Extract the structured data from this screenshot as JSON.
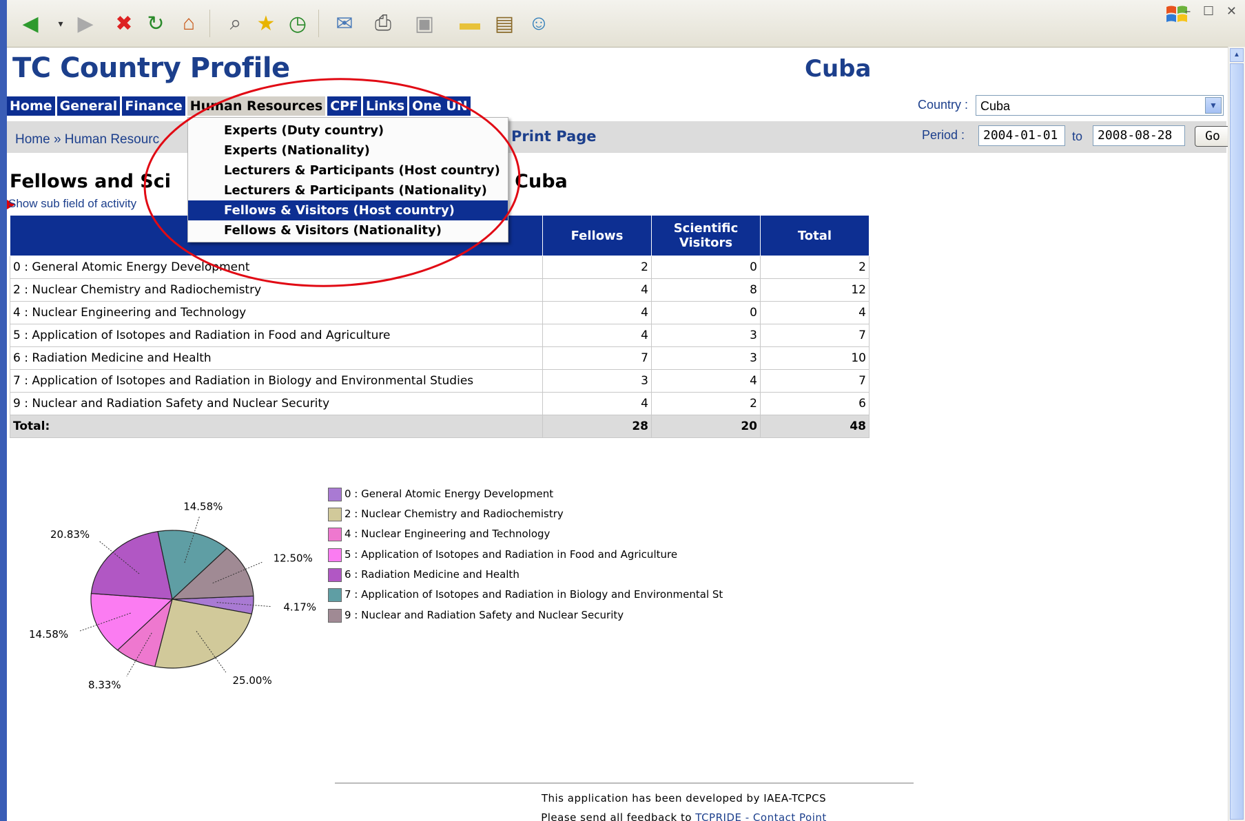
{
  "window": {
    "controls": "– ☐ ✕"
  },
  "header": {
    "app_title": "TC Country Profile",
    "country_title": "Cuba"
  },
  "nav": {
    "items": [
      "Home",
      "General",
      "Finance",
      "Human Resources",
      "CPF",
      "Links",
      "One UN"
    ]
  },
  "breadcrumb": "Home » Human Resourc",
  "print_page": "Print Page",
  "filters": {
    "country_label": "Country :",
    "country_value": "Cuba",
    "period_label": "Period :",
    "from": "2004-01-01",
    "to_label": "to",
    "to": "2008-08-28",
    "go": "Go"
  },
  "heading": {
    "left": "Fellows and Sci",
    "right": "ntry is Cuba"
  },
  "subfield_link": "Show sub field of activity",
  "dropdown_menu": {
    "items": [
      "Experts (Duty country)",
      "Experts (Nationality)",
      "Lecturers & Participants (Host country)",
      "Lecturers & Participants (Nationality)",
      "Fellows & Visitors (Host country)",
      "Fellows & Visitors (Nationality)"
    ],
    "selected_index": 4
  },
  "table": {
    "headers": [
      "",
      "Fellows",
      "Scientific Visitors",
      "Total"
    ],
    "rows": [
      {
        "field": "0 : General Atomic Energy Development",
        "fellows": "2",
        "visitors": "0",
        "total": "2"
      },
      {
        "field": "2 : Nuclear Chemistry and Radiochemistry",
        "fellows": "4",
        "visitors": "8",
        "total": "12"
      },
      {
        "field": "4 : Nuclear Engineering and Technology",
        "fellows": "4",
        "visitors": "0",
        "total": "4"
      },
      {
        "field": "5 : Application of Isotopes and Radiation in Food and Agriculture",
        "fellows": "4",
        "visitors": "3",
        "total": "7"
      },
      {
        "field": "6 : Radiation Medicine and Health",
        "fellows": "7",
        "visitors": "3",
        "total": "10"
      },
      {
        "field": "7 : Application of Isotopes and Radiation in Biology and Environmental Studies",
        "fellows": "3",
        "visitors": "4",
        "total": "7"
      },
      {
        "field": "9 : Nuclear and Radiation Safety and Nuclear Security",
        "fellows": "4",
        "visitors": "2",
        "total": "6"
      }
    ],
    "total": {
      "label": "Total:",
      "fellows": "28",
      "visitors": "20",
      "total": "48"
    }
  },
  "chart_data": {
    "type": "pie",
    "categories": [
      "0 : General Atomic Energy Development",
      "2 : Nuclear Chemistry and Radiochemistry",
      "4 : Nuclear Engineering and Technology",
      "5 : Application of Isotopes and Radiation in Food and Agriculture",
      "6 : Radiation Medicine and Health",
      "7 : Application of Isotopes and Radiation in Biology and Environmental St",
      "9 : Nuclear and Radiation Safety and Nuclear Security"
    ],
    "values": [
      4.17,
      25.0,
      8.33,
      14.58,
      20.83,
      14.58,
      12.5
    ],
    "labels": [
      "4.17%",
      "25.00%",
      "8.33%",
      "14.58%",
      "20.83%",
      "14.58%",
      "12.50%"
    ],
    "colors": [
      "#a97ad3",
      "#d1c99a",
      "#ee78cf",
      "#fb7cf2",
      "#b157c4",
      "#5f9ea4",
      "#a08a94"
    ]
  },
  "footer": {
    "line1": "This application has been developed by IAEA-TCPCS",
    "line2_prefix": "Please send all feedback to ",
    "line2_link": "TCPRIDE - Contact Point"
  }
}
